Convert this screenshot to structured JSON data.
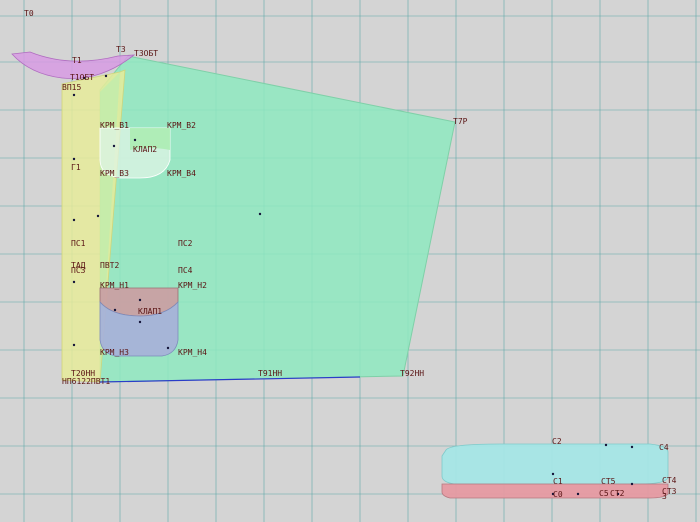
{
  "colors": {
    "background": "#d4d4d4",
    "grid": "#5fa8a8",
    "main_panel": "#8ee9bf",
    "side_strip": "#e6eb9a",
    "magenta_arc": "#d79be3",
    "shelf_fill": "#c9a0a3",
    "shelf_lower": "#a6b2d8",
    "small_panel": "#e0f4e6",
    "cyan_base": "#a5e6e6",
    "red_base": "#e69aa2",
    "label": "#5a1414",
    "dot": "#15153a",
    "blue_line": "#2a3cc8"
  },
  "labels": {
    "t0": "Т0",
    "t1": "Т1",
    "t3": "Т3",
    "t3obt": "Т3ОБТ",
    "t1obt": "Т1ОБТ",
    "vp15": "ВП15",
    "t7r": "Т7Р",
    "krm_v1": "КРМ_В1",
    "krm_v2": "КРМ_В2",
    "klap2": "КЛАП2",
    "g1": "Г1",
    "krm_v3": "КРМ_В3",
    "krm_v4": "КРМ_В4",
    "ps1": "ПС1",
    "ps2": "ПС2",
    "tad": "ТАД",
    "pvt2": "ПВТ2",
    "ps3": "ПС3",
    "ps4": "ПС4",
    "krm_n1": "КРМ_Н1",
    "krm_n2": "КРМ_Н2",
    "klap1": "КЛАП1",
    "krm_n3": "КРМ_Н3",
    "krm_n4": "КРМ_Н4",
    "t20nn": "Т20НН",
    "np": "НП6122ПВТ1",
    "t91nn": "Т91НН",
    "t92nn": "Т92НН",
    "s2": "С2",
    "s4": "С4",
    "st4": "СТ4",
    "st5": "СТ5",
    "s1": "С1",
    "s0": "С0",
    "st3": "СТ3",
    "s5": "С5",
    "sst2": "СТ2",
    "s3": "3"
  }
}
